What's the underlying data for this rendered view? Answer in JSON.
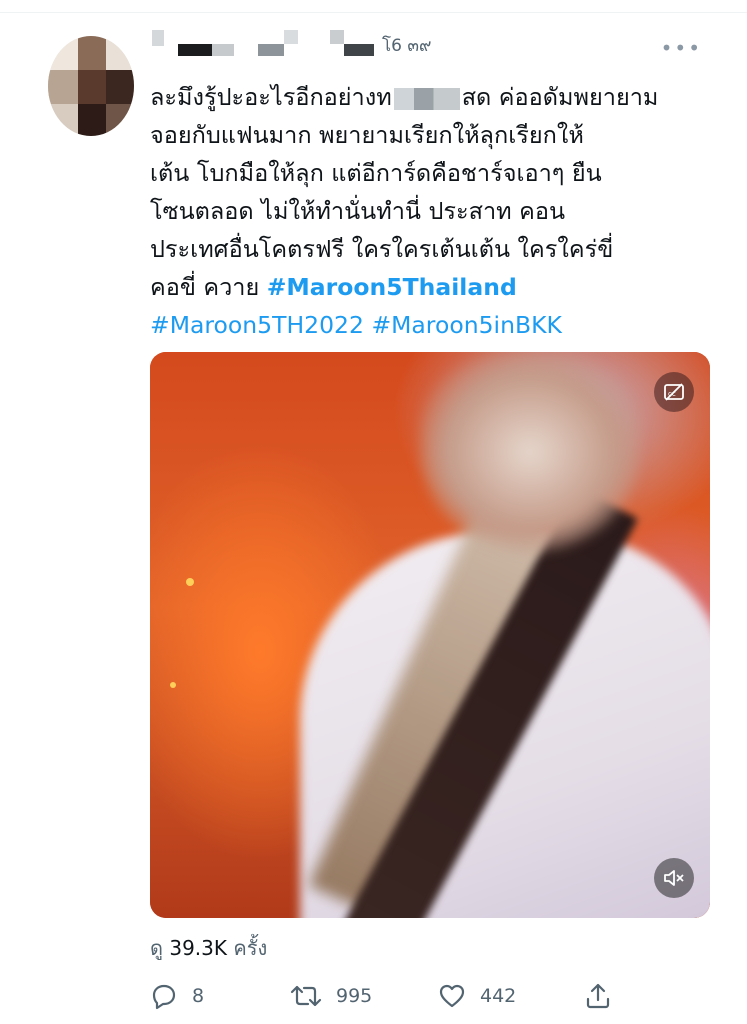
{
  "tweet": {
    "header": {
      "handle_suffix": "โ6 ๓๙"
    },
    "body_lines": [
      "ละมึงรู้ปะอะไรอีกอย่างท",
      "สด ค่ออดัมพยายาม",
      "จอยกับแฟนมาก พยายามเรียกให้ลุกเรียกให้",
      "เต้น โบกมือให้ลุก แต่อีการ์ดคือชาร์จเอาๆ ยืน",
      "โซนตลอด ไม่ให้ทำนั่นทำนี่ ประสาท คอน",
      "ประเทศอื่นโคตรฟรี ใครใครเต้นเต้น ใครใคร่ขี่",
      "คอขี่ ควาย "
    ],
    "hashtags": {
      "thailand": "#Maroon5Thailand",
      "th2022": "#Maroon5TH2022",
      "inbkk": "#Maroon5inBKK"
    },
    "media": {
      "cc_icon": "closed-captions-off-icon",
      "mute_icon": "speaker-muted-icon"
    },
    "views": {
      "prefix": "ดู",
      "count": "39.3K",
      "suffix": "ครั้ง"
    },
    "actions": {
      "reply_count": "8",
      "retweet_count": "995",
      "like_count": "442"
    }
  },
  "colors": {
    "link": "#1d9bf0",
    "secondary_text": "#536471",
    "primary_text": "#0f1419"
  }
}
